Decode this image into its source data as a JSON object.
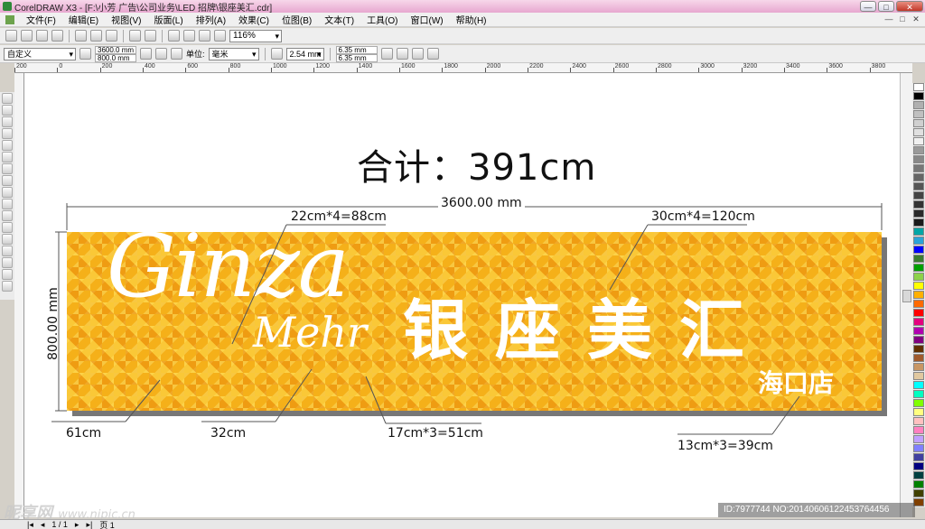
{
  "window": {
    "title": "CorelDRAW X3 - [F:\\小芳 广告\\公司业务\\LED 招牌\\银座美汇.cdr]",
    "minimize": "—",
    "maximize": "□",
    "close": "✕"
  },
  "menu": [
    "文件(F)",
    "编辑(E)",
    "视图(V)",
    "版面(L)",
    "排列(A)",
    "效果(C)",
    "位图(B)",
    "文本(T)",
    "工具(O)",
    "窗口(W)",
    "帮助(H)"
  ],
  "toolbar": {
    "zoom": "116%"
  },
  "property_bar": {
    "page_preset": "自定义",
    "width": "3600.0 mm",
    "height": "800.0 mm",
    "unit_label": "单位:",
    "unit": "毫米",
    "nudge": "2.54 mm",
    "dup_x": "6.35 mm",
    "dup_y": "6.35 mm"
  },
  "ruler": {
    "labels": [
      "200",
      "0",
      "200",
      "400",
      "600",
      "800",
      "1000",
      "1200",
      "1400",
      "1600",
      "1800",
      "2000",
      "2200",
      "2400",
      "2600",
      "2800",
      "3000",
      "3200",
      "3400",
      "3600",
      "3800"
    ]
  },
  "drawing": {
    "total": "合计：391cm",
    "width_dim": "3600.00 mm",
    "height_dim": "800.00 mm",
    "ginza": "Ginza",
    "mehr": "Mehr",
    "cn_name": "银座美汇",
    "cn_branch": "海口店",
    "notes": {
      "top_left": "22cm*4=88cm",
      "top_right": "30cm*4=120cm",
      "bottom_61": "61cm",
      "bottom_32": "32cm",
      "bottom_51": "17cm*3=51cm",
      "bottom_39": "13cm*3=39cm"
    }
  },
  "palette": [
    "#ffffff",
    "#000000",
    "#b0b0b0",
    "#c0c0c0",
    "#d0d0d0",
    "#e0e0e0",
    "#f0f0f0",
    "#9a9a9a",
    "#888888",
    "#777777",
    "#666666",
    "#555555",
    "#444444",
    "#333333",
    "#2a2a2a",
    "#1a1a1a",
    "#00a6a6",
    "#2aa3d8",
    "#0000ff",
    "#3b7d2f",
    "#00a000",
    "#8dd14a",
    "#ffff00",
    "#ffb000",
    "#ff6a00",
    "#ff0000",
    "#e4007f",
    "#b000b0",
    "#800080",
    "#603000",
    "#a05a2c",
    "#c89664",
    "#e0c8a0",
    "#00ffff",
    "#00ffc0",
    "#80ff00",
    "#ffff80",
    "#ffc0c0",
    "#ff80c0",
    "#c0a0ff",
    "#8080ff",
    "#4040a0",
    "#000080",
    "#004040",
    "#008000",
    "#404000",
    "#804000"
  ],
  "status": {
    "page_count": "1 / 1",
    "page_tab": "页 1"
  },
  "watermark": {
    "brand": "昵享网",
    "url": "www.nipic.cn",
    "id": "ID:7977744 NO:20140606122453764456"
  }
}
